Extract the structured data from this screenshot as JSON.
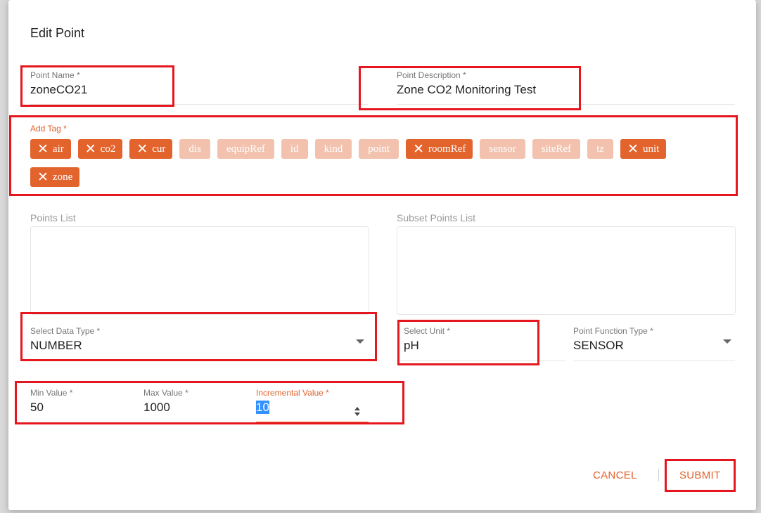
{
  "dialog": {
    "title": "Edit Point",
    "point_name": {
      "label": "Point Name *",
      "value": "zoneCO21"
    },
    "point_description": {
      "label": "Point Description *",
      "value": "Zone CO2 Monitoring Test"
    },
    "tags": {
      "label": "Add Tag *",
      "items": [
        {
          "label": "air",
          "selected": true
        },
        {
          "label": "co2",
          "selected": true
        },
        {
          "label": "cur",
          "selected": true
        },
        {
          "label": "dis",
          "selected": false
        },
        {
          "label": "equipRef",
          "selected": false
        },
        {
          "label": "id",
          "selected": false
        },
        {
          "label": "kind",
          "selected": false
        },
        {
          "label": "point",
          "selected": false
        },
        {
          "label": "roomRef",
          "selected": true
        },
        {
          "label": "sensor",
          "selected": false
        },
        {
          "label": "siteRef",
          "selected": false
        },
        {
          "label": "tz",
          "selected": false
        },
        {
          "label": "unit",
          "selected": true
        },
        {
          "label": "zone",
          "selected": true
        }
      ],
      "remove_icon": "close-icon"
    },
    "points_list": {
      "label": "Points List"
    },
    "subset_points_list": {
      "label": "Subset Points List"
    },
    "data_type": {
      "label": "Select Data Type *",
      "value": "NUMBER"
    },
    "unit": {
      "label": "Select Unit *",
      "value": "pH"
    },
    "function_type": {
      "label": "Point Function Type *",
      "value": "SENSOR"
    },
    "min_value": {
      "label": "Min Value *",
      "value": "50"
    },
    "max_value": {
      "label": "Max Value *",
      "value": "1000"
    },
    "incremental_value": {
      "label": "Incremental Value *",
      "value": "10"
    },
    "actions": {
      "cancel": "CANCEL",
      "submit": "SUBMIT"
    }
  },
  "colors": {
    "accent": "#e3632d",
    "chip_inactive": "#f2c2ae",
    "highlight": "#e5161d"
  }
}
